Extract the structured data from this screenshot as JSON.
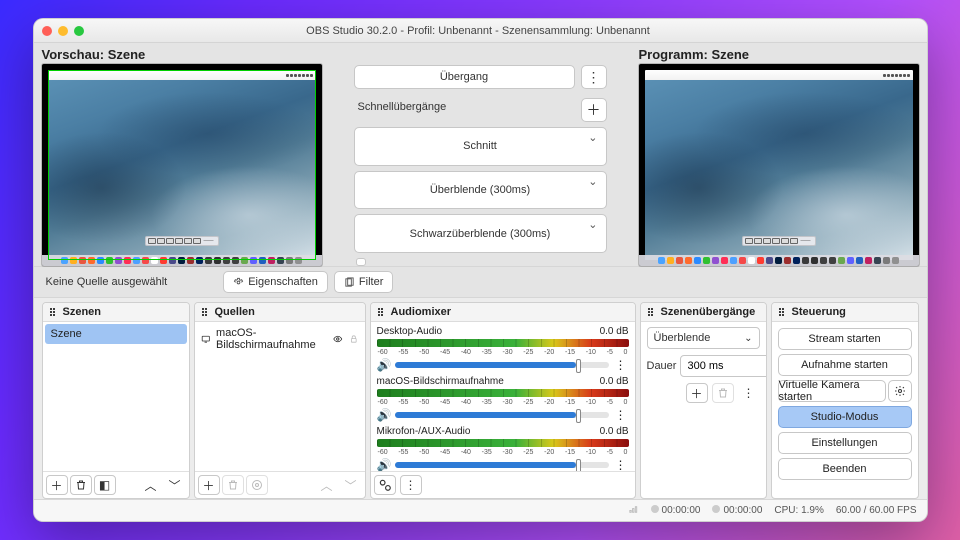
{
  "titlebar": {
    "title": "OBS Studio 30.2.0 - Profil: Unbenannt - Szenensammlung: Unbenannt"
  },
  "studio": {
    "preview_label": "Vorschau: Szene",
    "program_label": "Programm: Szene"
  },
  "transitions": {
    "transition": "Übergang",
    "quick_label": "Schnellübergänge",
    "cut": "Schnitt",
    "fade": "Überblende (300ms)",
    "blackfade": "Schwarzüberblende (300ms)"
  },
  "strip": {
    "no_source": "Keine Quelle ausgewählt",
    "properties": "Eigenschaften",
    "filters": "Filter"
  },
  "panels": {
    "scenes": {
      "title": "Szenen",
      "items": [
        "Szene"
      ]
    },
    "sources": {
      "title": "Quellen",
      "items": [
        {
          "label": "macOS-Bildschirmaufnahme"
        }
      ]
    },
    "mixer": {
      "title": "Audiomixer",
      "ticks": [
        "-60",
        "-55",
        "-50",
        "-45",
        "-40",
        "-35",
        "-30",
        "-25",
        "-20",
        "-15",
        "-10",
        "-5",
        "0"
      ],
      "items": [
        {
          "name": "Desktop-Audio",
          "level": "0.0 dB"
        },
        {
          "name": "macOS-Bildschirmaufnahme",
          "level": "0.0 dB"
        },
        {
          "name": "Mikrofon-/AUX-Audio",
          "level": "0.0 dB"
        }
      ]
    },
    "sceneT": {
      "title": "Szenenübergänge",
      "value": "Überblende",
      "duration_label": "Dauer",
      "duration": "300 ms"
    },
    "controls": {
      "title": "Steuerung",
      "stream": "Stream starten",
      "record": "Aufnahme starten",
      "vcam": "Virtuelle Kamera starten",
      "studio": "Studio-Modus",
      "settings": "Einstellungen",
      "exit": "Beenden"
    }
  },
  "status": {
    "time1": "00:00:00",
    "time2": "00:00:00",
    "cpu": "CPU: 1.9%",
    "fps": "60.00 / 60.00 FPS"
  },
  "dock_colors": [
    "#4aa3ff",
    "#ffb020",
    "#e9573f",
    "#ff6b2c",
    "#2b8aff",
    "#30c030",
    "#9050d0",
    "#ff2d55",
    "#4da0ff",
    "#f54848",
    "#ffffff",
    "#ff3b30",
    "#4a4a8a",
    "#001c3d",
    "#9b2d2d",
    "#00215b",
    "#3a3a3a",
    "#303030",
    "#404040",
    "#404040",
    "#6aa84f",
    "#6060ff",
    "#2060c0",
    "#c02060",
    "#364452",
    "#7a7a7a",
    "#909090"
  ]
}
